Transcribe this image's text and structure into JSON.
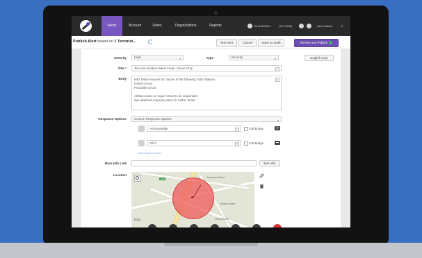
{
  "nav": {
    "tabs": [
      "Alerts",
      "Account",
      "Users",
      "Organizations",
      "Reports"
    ],
    "active_tab": "Alerts",
    "org_label": "ALLIANCES...",
    "count_label": "(712 OHB)",
    "user_label": "Alan Halleck"
  },
  "header": {
    "title_prefix": "Publish Alert",
    "based_on": "based on",
    "template_name": "1 Terrorist...",
    "buttons": {
      "test_alert": "Test Alert",
      "cancel": "Cancel",
      "save_draft": "Save as Draft",
      "review_publish": "Review and Publish"
    }
  },
  "form": {
    "severity_label": "Severity",
    "severity_value": "High",
    "type_label": "Type",
    "type_value": "Security",
    "language_value": "English (US)",
    "title_label": "Title *",
    "title_value": "Terrorist Incident Week Fired - Demo Only",
    "body_label": "Body",
    "body_text": "MET Police request for closure of the following Tube Stations:\nOxford Circus\nPiccadilly Circus\n\nAll Bus routes on regent street to be suspended.\nSee attached response plans for further detail",
    "response_label": "Response Options",
    "response_value": "Custom Response Options",
    "options": [
      "Acknowledge",
      "Off d"
    ],
    "call_bridge_label": "Call Bridge",
    "add_option_link": "Add response option",
    "more_info_label": "More Info Link",
    "test_url_button": "Test URL",
    "location_label": "Location"
  },
  "map": {
    "labels": [
      "Grosvenor Street",
      "Regent Street",
      "Oxford Street"
    ],
    "shield": "A40",
    "provider": "bing"
  },
  "colors": {
    "nav_bg": "#2a2a2a",
    "accent": "#7a56c0",
    "circle": "#f05a5a",
    "page_bg": "#3a6ec0"
  }
}
